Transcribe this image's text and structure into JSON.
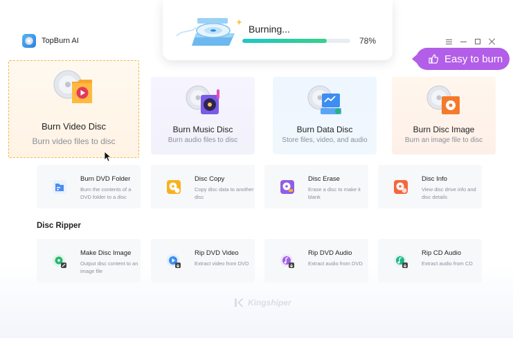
{
  "app": {
    "name": "TopBurn AI",
    "logo_icon": "disc-logo-icon"
  },
  "window_controls": [
    "menu-icon",
    "minimize-icon",
    "maximize-icon",
    "close-icon"
  ],
  "burning": {
    "title": "Burning...",
    "progress_percent": 78,
    "progress_label": "78%"
  },
  "promo": {
    "label": "Easy to burn",
    "icon": "thumbs-up-icon",
    "color": "#b25ee8"
  },
  "big_cards": {
    "video": {
      "title": "Burn Video Disc",
      "subtitle": "Burn video files to disc",
      "icon": "video-disc-icon",
      "selected": true
    },
    "music": {
      "title": "Burn Music Disc",
      "subtitle": "Burn audio files to disc",
      "icon": "music-disc-icon"
    },
    "data": {
      "title": "Burn Data Disc",
      "subtitle": "Store files, video, and audio",
      "icon": "data-disc-icon"
    },
    "image": {
      "title": "Burn Disc Image",
      "subtitle": "Burn an image file to disc",
      "icon": "image-disc-icon"
    }
  },
  "tools": [
    {
      "title": "Burn DVD Folder",
      "desc": "Burn the contents of a DVD folder to a disc",
      "icon": "dvd-folder-icon"
    },
    {
      "title": "Disc Copy",
      "desc": "Copy disc data to another disc",
      "icon": "disc-copy-icon"
    },
    {
      "title": "Disc Erase",
      "desc": "Erase a disc to make it blank",
      "icon": "disc-erase-icon"
    },
    {
      "title": "Disc Info",
      "desc": "View disc drive info and disc details",
      "icon": "disc-info-icon"
    }
  ],
  "ripper": {
    "section_title": "Disc Ripper",
    "items": [
      {
        "title": "Make Disc Image",
        "desc": "Output disc content to an image file",
        "icon": "make-image-icon"
      },
      {
        "title": "Rip DVD Video",
        "desc": "Extract video from DVD",
        "icon": "rip-dvd-video-icon"
      },
      {
        "title": "Rip DVD Audio",
        "desc": "Extract audio from DVD",
        "icon": "rip-dvd-audio-icon"
      },
      {
        "title": "Rip CD Audio",
        "desc": "Extract audio from CD",
        "icon": "rip-cd-audio-icon"
      }
    ]
  },
  "watermark": "Kingshiper"
}
